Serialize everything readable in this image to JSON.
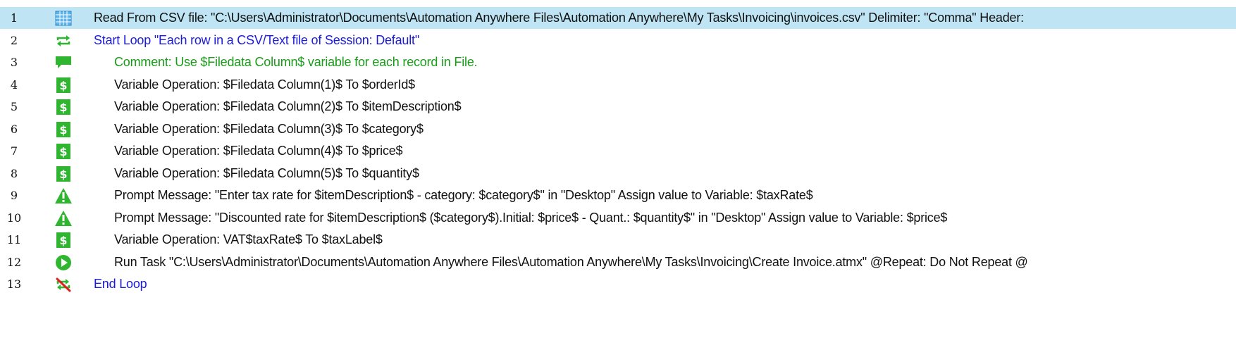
{
  "colors": {
    "selection": "#bfe4f4",
    "keyword_blue": "#1c1cd8",
    "comment_green": "#1a9b1a",
    "icon_green": "#2fb52f"
  },
  "lines": [
    {
      "num": "1",
      "icon": "csv-grid-icon",
      "color": "black",
      "indent": 0,
      "selected": true,
      "text": "Read From CSV file: \"C:\\Users\\Administrator\\Documents\\Automation Anywhere Files\\Automation Anywhere\\My Tasks\\Invoicing\\invoices.csv\" Delimiter: \"Comma\" Header:"
    },
    {
      "num": "2",
      "icon": "loop-icon",
      "color": "blue",
      "indent": 0,
      "text": "Start Loop \"Each row in a CSV/Text file of Session: Default\""
    },
    {
      "num": "3",
      "icon": "comment-icon",
      "color": "green",
      "indent": 1,
      "text": "Comment: Use $Filedata Column$ variable for each record in File."
    },
    {
      "num": "4",
      "icon": "variable-dollar-icon",
      "color": "black",
      "indent": 1,
      "text": "Variable Operation: $Filedata Column(1)$ To $orderId$"
    },
    {
      "num": "5",
      "icon": "variable-dollar-icon",
      "color": "black",
      "indent": 1,
      "text": "Variable Operation: $Filedata Column(2)$ To $itemDescription$"
    },
    {
      "num": "6",
      "icon": "variable-dollar-icon",
      "color": "black",
      "indent": 1,
      "text": "Variable Operation: $Filedata Column(3)$ To $category$"
    },
    {
      "num": "7",
      "icon": "variable-dollar-icon",
      "color": "black",
      "indent": 1,
      "text": "Variable Operation: $Filedata Column(4)$ To $price$"
    },
    {
      "num": "8",
      "icon": "variable-dollar-icon",
      "color": "black",
      "indent": 1,
      "text": "Variable Operation: $Filedata Column(5)$ To $quantity$"
    },
    {
      "num": "9",
      "icon": "prompt-warning-icon",
      "color": "black",
      "indent": 1,
      "text": "Prompt Message: \"Enter tax rate for $itemDescription$ - category: $category$\" in \"Desktop\" Assign value to Variable: $taxRate$"
    },
    {
      "num": "10",
      "icon": "prompt-warning-icon",
      "color": "black",
      "indent": 1,
      "text": "Prompt Message: \"Discounted rate for $itemDescription$ ($category$).Initial: $price$ - Quant.: $quantity$\" in \"Desktop\" Assign value to Variable: $price$"
    },
    {
      "num": "11",
      "icon": "variable-dollar-icon",
      "color": "black",
      "indent": 1,
      "text": "Variable Operation: VAT$taxRate$ To $taxLabel$"
    },
    {
      "num": "12",
      "icon": "run-task-play-icon",
      "color": "black",
      "indent": 1,
      "text": "Run Task \"C:\\Users\\Administrator\\Documents\\Automation Anywhere Files\\Automation Anywhere\\My Tasks\\Invoicing\\Create Invoice.atmx\" @Repeat: Do Not Repeat @"
    },
    {
      "num": "13",
      "icon": "end-loop-icon",
      "color": "blue",
      "indent": 0,
      "text": "End Loop"
    }
  ]
}
